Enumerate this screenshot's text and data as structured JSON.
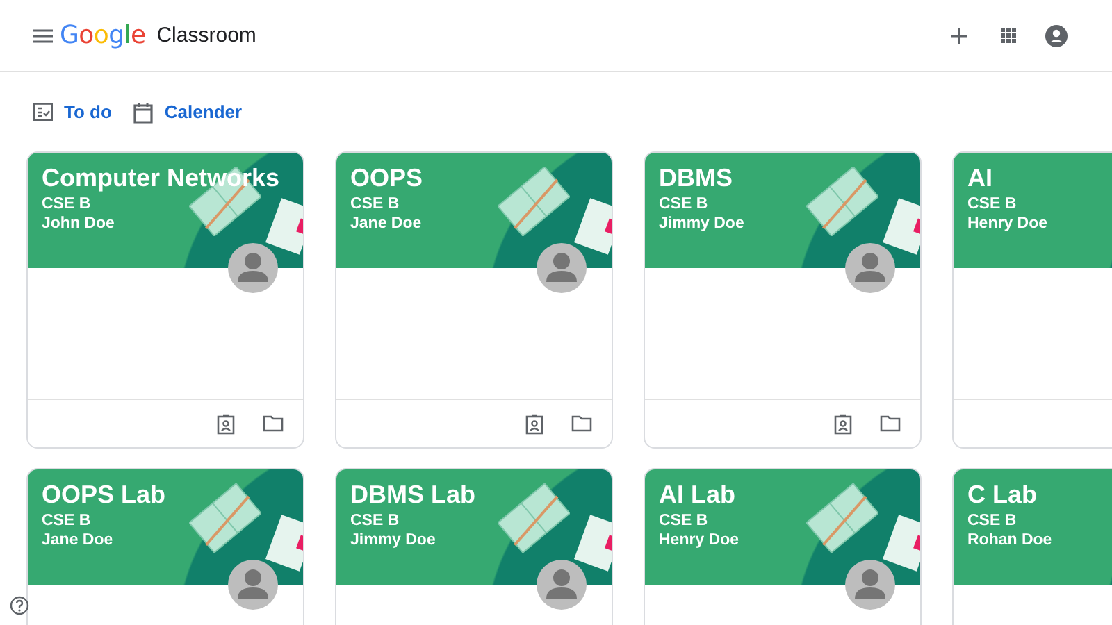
{
  "header": {
    "logo": "Google",
    "app_name": "Classroom"
  },
  "nav": [
    {
      "kind": "todo",
      "label": "To do"
    },
    {
      "kind": "calendar",
      "label": "Calender"
    }
  ],
  "courses": [
    {
      "title": "Computer Networks",
      "section": "CSE B",
      "teacher": "John Doe"
    },
    {
      "title": "OOPS",
      "section": "CSE B",
      "teacher": "Jane Doe"
    },
    {
      "title": "DBMS",
      "section": "CSE B",
      "teacher": "Jimmy Doe"
    },
    {
      "title": "AI",
      "section": "CSE B",
      "teacher": "Henry Doe"
    },
    {
      "title": "OOPS Lab",
      "section": "CSE B",
      "teacher": "Jane Doe"
    },
    {
      "title": "DBMS Lab",
      "section": "CSE B",
      "teacher": "Jimmy Doe"
    },
    {
      "title": "AI Lab",
      "section": "CSE B",
      "teacher": "Henry Doe"
    },
    {
      "title": "C Lab",
      "section": "CSE B",
      "teacher": "Rohan Doe"
    }
  ]
}
